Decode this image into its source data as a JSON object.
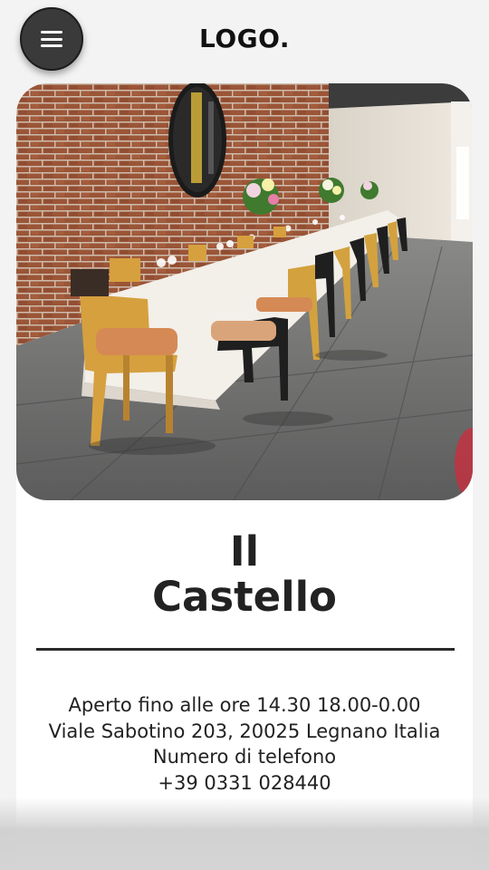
{
  "header": {
    "menu_icon": "hamburger-menu-icon",
    "logo_text": "LOGO."
  },
  "hero": {
    "image_description": "restaurant-interior-photo"
  },
  "restaurant": {
    "name_line1": "Il",
    "name_line2": "Castello"
  },
  "info": {
    "hours": "Aperto fino alle ore 14.30 18.00-0.00",
    "address": "Viale Sabotino 203, 20025 Legnano Italia",
    "phone_label": "Numero di telefono",
    "phone_number": "+39 0331 028440"
  },
  "colors": {
    "text": "#222222",
    "card": "#ffffff",
    "background": "#f3f3f3",
    "menu_button": "#3a3a3a"
  }
}
